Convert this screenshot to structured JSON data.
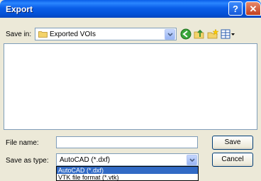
{
  "window": {
    "title": "Export"
  },
  "title_buttons": {
    "help": "?",
    "close": "✕"
  },
  "save_in": {
    "label": "Save in:",
    "value": "Exported VOIs"
  },
  "toolbar": {
    "back_icon": "back-icon",
    "up_icon": "up-folder-icon",
    "new_folder_icon": "new-folder-icon",
    "views_icon": "views-menu-icon"
  },
  "file_name": {
    "label": "File name:",
    "value": ""
  },
  "save_as_type": {
    "label": "Save as type:",
    "value": "AutoCAD (*.dxf)",
    "options": [
      "AutoCAD (*.dxf)",
      "VTK file format (*.vtk)"
    ],
    "selected_index": 0
  },
  "buttons": {
    "save": "Save",
    "cancel": "Cancel"
  },
  "colors": {
    "title_bar": "#0a5ee8",
    "dialog_bg": "#ece9d8",
    "selection": "#316ac5",
    "field_border": "#7f9db9"
  }
}
